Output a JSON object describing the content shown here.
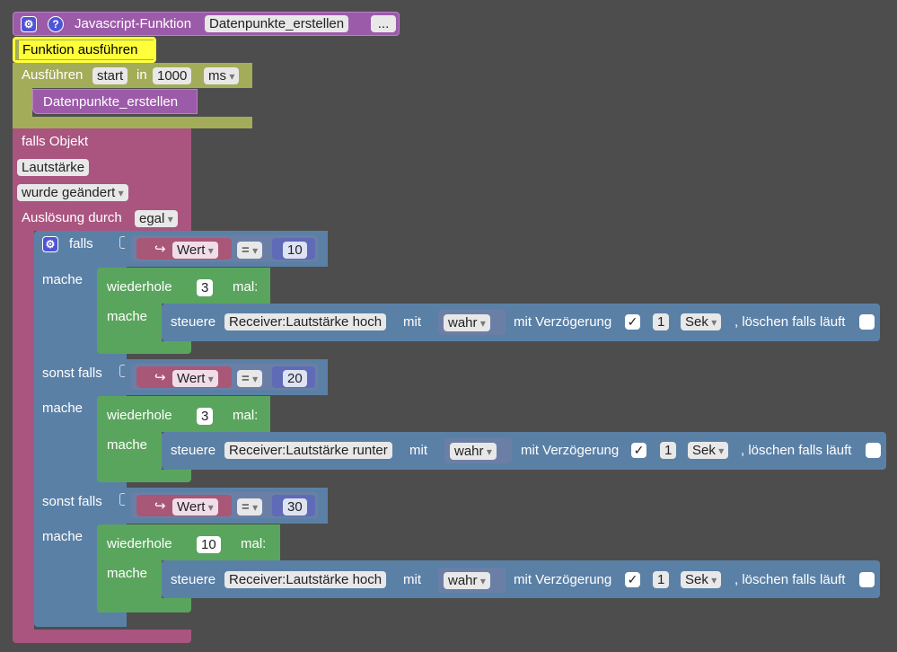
{
  "header": {
    "title": "Javascript-Funktion",
    "function_name": "Datenpunkte_erstellen",
    "more_label": "...",
    "gear_icon": "gear-icon",
    "help_icon": "question-icon"
  },
  "execute_block": {
    "label": "Funktion ausführen"
  },
  "timer_block": {
    "label": "Ausführen",
    "mode": "start",
    "in_label": "in",
    "delay": "1000",
    "unit": "ms"
  },
  "call_block": {
    "label": "Datenpunkte_erstellen"
  },
  "trigger_block": {
    "label": "falls Objekt",
    "object": "Lautstärke",
    "condition": "wurde geändert",
    "trigger_label": "Auslösung durch",
    "trigger_value": "egal"
  },
  "if_block": {
    "if_label": "falls",
    "elseif_label": "sonst falls",
    "do_label": "mache",
    "branches": [
      {
        "var": "Wert",
        "op": "=",
        "value": "10",
        "repeat_label": "wiederhole",
        "repeat_count": "3",
        "times_label": "mal:",
        "do_label": "mache",
        "action": {
          "label": "steuere",
          "target": "Receiver:Lautstärke hoch",
          "with_label": "mit",
          "value": "wahr",
          "delay_label": "mit Verzögerung",
          "delay_checked": "✓",
          "delay_value": "1",
          "delay_unit": "Sek",
          "clear_label": ", löschen falls läuft"
        }
      },
      {
        "var": "Wert",
        "op": "=",
        "value": "20",
        "repeat_label": "wiederhole",
        "repeat_count": "3",
        "times_label": "mal:",
        "do_label": "mache",
        "action": {
          "label": "steuere",
          "target": "Receiver:Lautstärke runter",
          "with_label": "mit",
          "value": "wahr",
          "delay_label": "mit Verzögerung",
          "delay_checked": "✓",
          "delay_value": "1",
          "delay_unit": "Sek",
          "clear_label": ", löschen falls läuft"
        }
      },
      {
        "var": "Wert",
        "op": "=",
        "value": "30",
        "repeat_label": "wiederhole",
        "repeat_count": "10",
        "times_label": "mal:",
        "do_label": "mache",
        "action": {
          "label": "steuere",
          "target": "Receiver:Lautstärke hoch",
          "with_label": "mit",
          "value": "wahr",
          "delay_label": "mit Verzögerung",
          "delay_checked": "✓",
          "delay_value": "1",
          "delay_unit": "Sek",
          "clear_label": ", löschen falls läuft"
        }
      }
    ]
  },
  "colors": {
    "background": "#4d4d4d",
    "function_block": "#9c5ba8",
    "highlight": "#ffff3a",
    "timer_block": "#a3ad59",
    "trigger_block": "#a9557f",
    "logic_block": "#5b80a6",
    "loop_block": "#5aa55d"
  }
}
